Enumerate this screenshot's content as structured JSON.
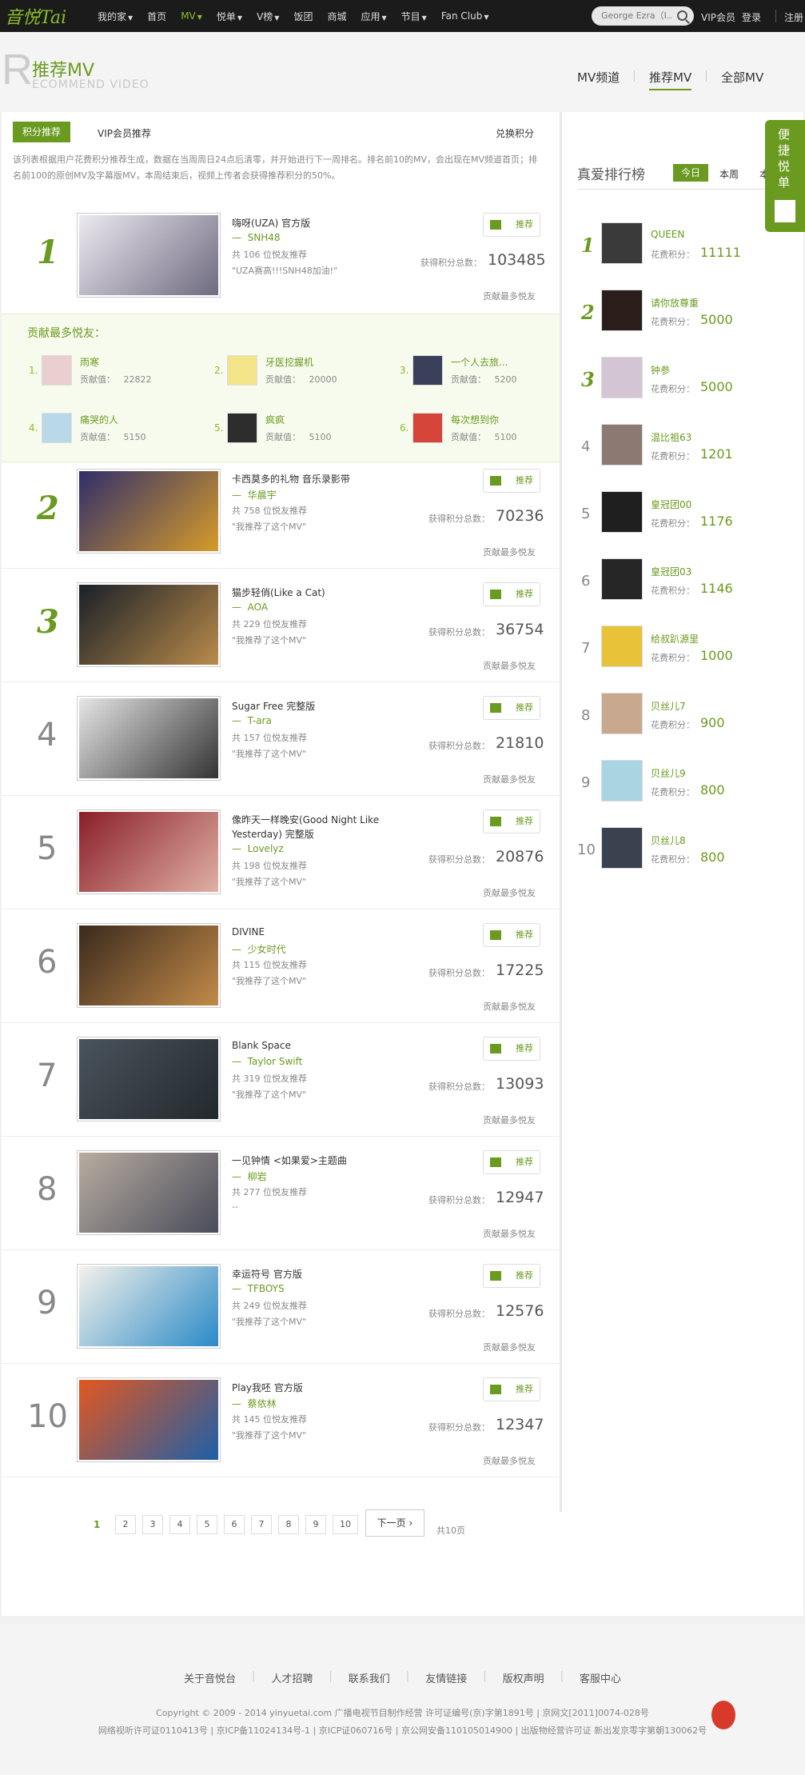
{
  "topnav": {
    "logo": "音悦Tai",
    "items": [
      "我的家",
      "首页",
      "MV",
      "悦单",
      "V榜",
      "饭团",
      "商城",
      "应用",
      "节目",
      "Fan Club"
    ],
    "search_placeholder": "George Ezra（I...",
    "vip": "VIP会员",
    "login": "登录",
    "register": "注册"
  },
  "header": {
    "title": "推荐MV",
    "subtitle": "ECOMMEND VIDEO",
    "nav": [
      "MV频道",
      "推荐MV",
      "全部MV"
    ]
  },
  "tabs": {
    "points": "积分推荐",
    "vip": "VIP会员推荐",
    "redeem": "兑换积分"
  },
  "description": "该列表根据用户花费积分推荐生成，数据在当周周日24点后清零，并开始进行下一周排名。排名前10的MV，会出现在MV频道首页；排名前100的原创MV及字幕版MV，本周结束后，视频上传者会获得推荐积分的50%。",
  "mv_items": [
    {
      "rank": "1",
      "title": "嗨呀(UZA) 官方版",
      "artist": "SNH48",
      "count": "共 106 位悦友推荐",
      "quote": "\"UZA赛高!!!SNH48加油!\"",
      "score_label": "获得积分总数：",
      "score": "103485",
      "btn": "推荐",
      "fans": "贡献最多悦友",
      "colors": [
        "#ece9f1",
        "#6f6b80"
      ]
    },
    {
      "rank": "2",
      "title": "卡西莫多的礼物 音乐录影带",
      "artist": "华晨宇",
      "count": "共 758 位悦友推荐",
      "quote": "\"我推荐了这个MV\"",
      "score_label": "获得积分总数：",
      "score": "70236",
      "btn": "推荐",
      "fans": "贡献最多悦友",
      "colors": [
        "#302e6a",
        "#d69b2a"
      ]
    },
    {
      "rank": "3",
      "title": "猫步轻俏(Like a Cat)",
      "artist": "AOA",
      "count": "共 229 位悦友推荐",
      "quote": "\"我推荐了这个MV\"",
      "score_label": "获得积分总数：",
      "score": "36754",
      "btn": "推荐",
      "fans": "贡献最多悦友",
      "colors": [
        "#1a2028",
        "#b98b4a"
      ]
    },
    {
      "rank": "4",
      "title": "Sugar Free 完整版",
      "artist": "T-ara",
      "count": "共 157 位悦友推荐",
      "quote": "\"我推荐了这个MV\"",
      "score_label": "获得积分总数：",
      "score": "21810",
      "btn": "推荐",
      "fans": "贡献最多悦友",
      "colors": [
        "#e6e6e6",
        "#333333"
      ]
    },
    {
      "rank": "5",
      "title": "像昨天一样晚安(Good Night Like Yesterday) 完整版",
      "artist": "Lovelyz",
      "count": "共 198 位悦友推荐",
      "quote": "\"我推荐了这个MV\"",
      "score_label": "获得积分总数：",
      "score": "20876",
      "btn": "推荐",
      "fans": "贡献最多悦友",
      "colors": [
        "#8a1f26",
        "#e0b0a5"
      ]
    },
    {
      "rank": "6",
      "title": "DIVINE",
      "artist": "少女时代",
      "count": "共 115 位悦友推荐",
      "quote": "\"我推荐了这个MV\"",
      "score_label": "获得积分总数：",
      "score": "17225",
      "btn": "推荐",
      "fans": "贡献最多悦友",
      "colors": [
        "#3a2a1c",
        "#c28a4a"
      ]
    },
    {
      "rank": "7",
      "title": "Blank Space",
      "artist": "Taylor Swift",
      "count": "共 319 位悦友推荐",
      "quote": "\"我推荐了这个MV\"",
      "score_label": "获得积分总数：",
      "score": "13093",
      "btn": "推荐",
      "fans": "贡献最多悦友",
      "colors": [
        "#4a545c",
        "#22282e"
      ]
    },
    {
      "rank": "8",
      "title": "一见钟情 <如果爱>主题曲",
      "artist": "柳岩",
      "count": "共 277 位悦友推荐",
      "quote": "--",
      "score_label": "获得积分总数：",
      "score": "12947",
      "btn": "推荐",
      "fans": "贡献最多悦友",
      "colors": [
        "#b7aca0",
        "#4a4c5a"
      ]
    },
    {
      "rank": "9",
      "title": "幸运符号 官方版",
      "artist": "TFBOYS",
      "count": "共 249 位悦友推荐",
      "quote": "\"我推荐了这个MV\"",
      "score_label": "获得积分总数：",
      "score": "12576",
      "btn": "推荐",
      "fans": "贡献最多悦友",
      "colors": [
        "#f4f1ea",
        "#2a8ac8"
      ]
    },
    {
      "rank": "10",
      "title": "Play我呸 官方版",
      "artist": "蔡依林",
      "count": "共 145 位悦友推荐",
      "quote": "\"我推荐了这个MV\"",
      "score_label": "获得积分总数：",
      "score": "12347",
      "btn": "推荐",
      "fans": "贡献最多悦友",
      "colors": [
        "#e2571f",
        "#1e5fa8"
      ]
    }
  ],
  "contributors": {
    "title": "贡献最多悦友：",
    "label": "贡献值：",
    "items": [
      {
        "idx": "1.",
        "name": "雨寒",
        "value": "22822",
        "color": "#e9cfd0"
      },
      {
        "idx": "2.",
        "name": "牙医挖握机",
        "value": "20000",
        "color": "#f3e48a"
      },
      {
        "idx": "3.",
        "name": "一个人去旅...",
        "value": "5200",
        "color": "#3a3f5a"
      },
      {
        "idx": "4.",
        "name": "痛哭的人",
        "value": "5150",
        "color": "#b9d8e8"
      },
      {
        "idx": "5.",
        "name": "疯疯",
        "value": "5100",
        "color": "#2d2d2d"
      },
      {
        "idx": "6.",
        "name": "每次想到你",
        "value": "5100",
        "color": "#d6453a"
      }
    ]
  },
  "ranking": {
    "title": "真爱排行榜",
    "tabs": [
      "今日",
      "本周",
      "本月"
    ],
    "label": "花费积分：",
    "items": [
      {
        "rank": "1",
        "name": "QUEEN",
        "score": "11111",
        "color": "#3a3a3a"
      },
      {
        "rank": "2",
        "name": "请你放尊重",
        "score": "5000",
        "color": "#2b1e1a"
      },
      {
        "rank": "3",
        "name": "钟参",
        "score": "5000",
        "color": "#d3c5d4"
      },
      {
        "rank": "4",
        "name": "温比祖63",
        "score": "1201",
        "color": "#8c7a72"
      },
      {
        "rank": "5",
        "name": "皇冠团00",
        "score": "1176",
        "color": "#1f1f1f"
      },
      {
        "rank": "6",
        "name": "皇冠团03",
        "score": "1146",
        "color": "#262626"
      },
      {
        "rank": "7",
        "name": "给叔趴源里",
        "score": "1000",
        "color": "#e8c33a"
      },
      {
        "rank": "8",
        "name": "贝丝儿7",
        "score": "900",
        "color": "#c9a890"
      },
      {
        "rank": "9",
        "name": "贝丝儿9",
        "score": "800",
        "color": "#a9d4e2"
      },
      {
        "rank": "10",
        "name": "贝丝儿8",
        "score": "800",
        "color": "#3a4250"
      }
    ]
  },
  "fav_sidebar": "便捷悦单",
  "pagination": {
    "current": "1",
    "pages": [
      "2",
      "3",
      "4",
      "5",
      "6",
      "7",
      "8",
      "9",
      "10"
    ],
    "next": "下一页",
    "total": "共10页"
  },
  "footer": {
    "links": [
      "关于音悦台",
      "人才招聘",
      "联系我们",
      "友情链接",
      "版权声明",
      "客服中心"
    ],
    "copyright": "Copyright © 2009 - 2014 yinyuetai.com 广播电视节目制作经营 许可证编号(京)字第1891号 | 京网文[2011]0074-028号",
    "license": "网络视听许可证0110413号 | 京ICP备11024134号-1 | 京ICP证060716号 | 京公网安备110105014900 | 出版物经营许可证 新出发京零字第朝130062号"
  }
}
